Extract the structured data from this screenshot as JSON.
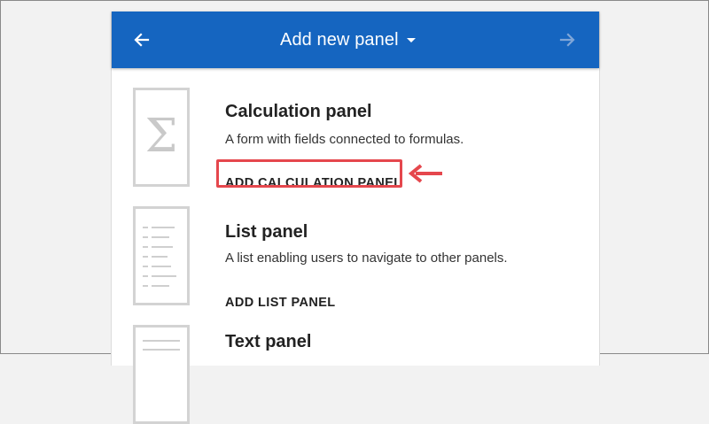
{
  "header": {
    "title": "Add new panel",
    "back_icon": "arrow-left-icon",
    "forward_icon": "arrow-right-icon",
    "dropdown_icon": "caret-down-icon",
    "bar_color": "#1565c0"
  },
  "panels": [
    {
      "title": "Calculation panel",
      "description": "A form with fields connected to formulas.",
      "button": "ADD CALCULATION PANEL",
      "icon": "sigma-icon",
      "highlighted": true
    },
    {
      "title": "List panel",
      "description": "A list enabling users to navigate to other panels.",
      "button": "ADD LIST PANEL",
      "icon": "list-icon"
    },
    {
      "title": "Text panel",
      "icon": "text-icon"
    }
  ],
  "annotation": {
    "color": "#e5474d",
    "arrow_icon": "callout-arrow-icon"
  }
}
